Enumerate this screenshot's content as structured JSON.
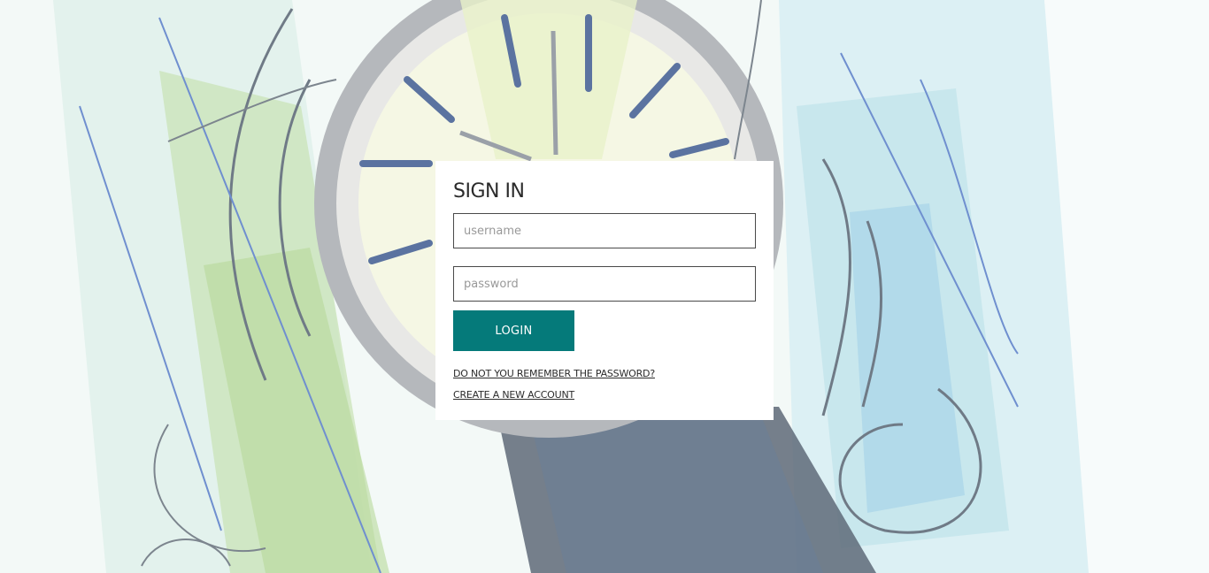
{
  "signin": {
    "title": "SIGN IN",
    "username_placeholder": "username",
    "password_placeholder": "password",
    "username_value": "",
    "password_value": "",
    "login_label": "LOGIN",
    "forgot_link": "DO NOT YOU REMEMBER THE PASSWORD?",
    "create_link": "CREATE A NEW ACCOUNT"
  },
  "colors": {
    "accent": "#057a7a",
    "card_bg": "#ffffff",
    "text": "#2b2b2b"
  },
  "background": {
    "description_icon": "watch-sketch-illustration"
  }
}
